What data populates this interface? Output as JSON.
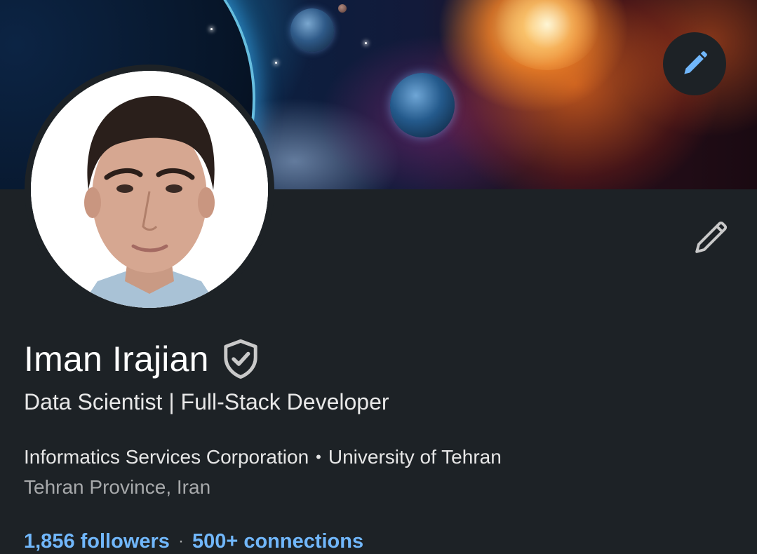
{
  "profile": {
    "name": "Iman Irajian",
    "headline": "Data Scientist | Full-Stack Developer",
    "company": "Informatics Services Corporation",
    "separator": "•",
    "school": "University of Tehran",
    "location": "Tehran Province, Iran",
    "followers": "1,856 followers",
    "network_separator": "·",
    "connections": "500+ connections"
  },
  "icons": {
    "cover_edit": "pencil-icon",
    "intro_edit": "pencil-icon",
    "verified": "verified-shield-icon"
  },
  "colors": {
    "background": "#1d2226",
    "link_blue": "#71b7fb",
    "primary_text": "#ffffff",
    "secondary_text": "#a7a9ab"
  }
}
